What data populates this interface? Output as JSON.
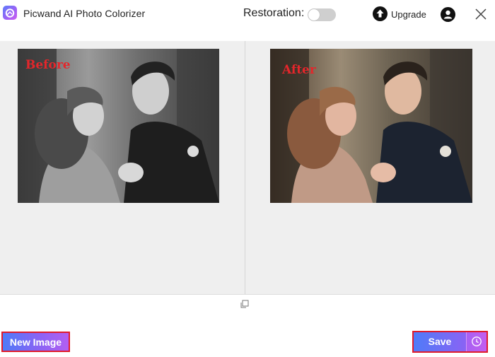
{
  "header": {
    "app_title": "Picwand AI Photo Colorizer",
    "restoration_label": "Restoration:",
    "restoration_enabled": false,
    "upgrade_label": "Upgrade",
    "icons": {
      "logo": "picwand-logo-icon",
      "upgrade": "arrow-up-circle-icon",
      "account": "user-icon",
      "close": "close-icon"
    }
  },
  "preview": {
    "before_label": "Before",
    "after_label": "After",
    "fit_icon": "fit-to-screen-icon"
  },
  "footer": {
    "new_image_label": "New Image",
    "save_label": "Save",
    "history_icon": "clock-icon"
  },
  "colors": {
    "accent_start": "#4f7bf8",
    "accent_end": "#b25ff2",
    "highlight_border": "#e01b2b",
    "tag_red": "#e4262b",
    "workspace_bg": "#efefef"
  }
}
